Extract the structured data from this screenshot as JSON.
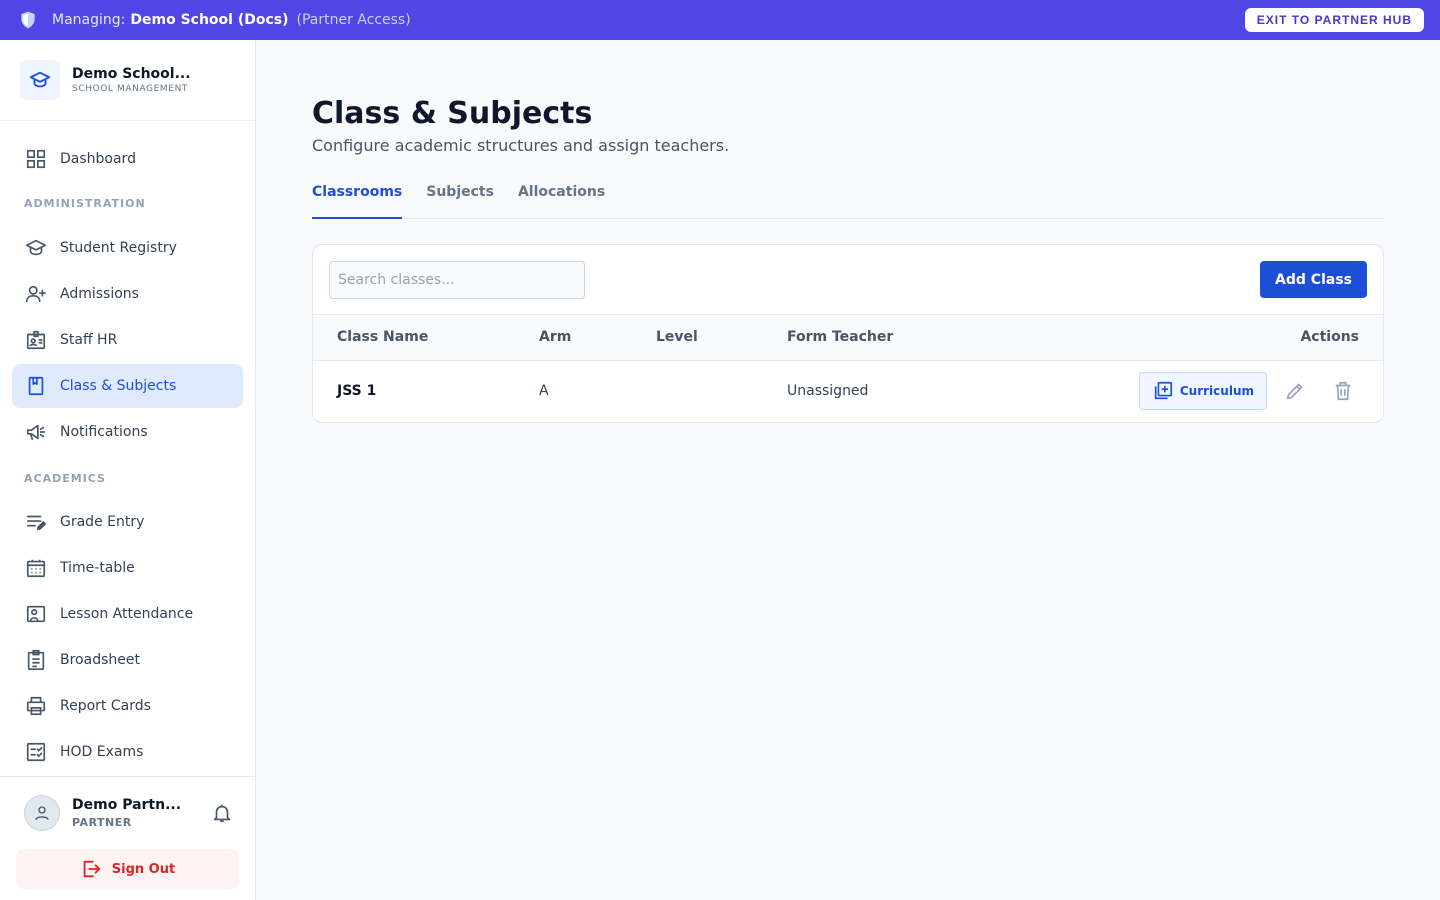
{
  "banner": {
    "managing_label": "Managing:",
    "school_name": "Demo School (Docs)",
    "access_note": "(Partner Access)",
    "exit_label": "EXIT TO PARTNER HUB",
    "icon": "shield-icon"
  },
  "brand": {
    "name": "Demo School...",
    "subtitle": "SCHOOL MANAGEMENT",
    "icon": "graduation-cap-icon"
  },
  "sidebar": {
    "dashboard": "Dashboard",
    "admin_section": "ADMINISTRATION",
    "admin_items": [
      {
        "label": "Student Registry",
        "icon": "graduation-cap-icon"
      },
      {
        "label": "Admissions",
        "icon": "user-plus-icon"
      },
      {
        "label": "Staff HR",
        "icon": "id-badge-icon"
      },
      {
        "label": "Class & Subjects",
        "icon": "book-icon",
        "active": true
      },
      {
        "label": "Notifications",
        "icon": "megaphone-icon"
      }
    ],
    "academics_section": "ACADEMICS",
    "academic_items": [
      {
        "label": "Grade Entry",
        "icon": "edit-list-icon"
      },
      {
        "label": "Time-table",
        "icon": "calendar-icon"
      },
      {
        "label": "Lesson Attendance",
        "icon": "present-icon"
      },
      {
        "label": "Broadsheet",
        "icon": "clipboard-icon"
      },
      {
        "label": "Report Cards",
        "icon": "printer-icon"
      },
      {
        "label": "HOD Exams",
        "icon": "checklist-icon"
      }
    ]
  },
  "user": {
    "name": "Demo Partn...",
    "role": "PARTNER",
    "sign_out": "Sign Out"
  },
  "page": {
    "title": "Class & Subjects",
    "subtitle": "Configure academic structures and assign teachers."
  },
  "tabs": [
    {
      "label": "Classrooms",
      "active": true
    },
    {
      "label": "Subjects"
    },
    {
      "label": "Allocations"
    }
  ],
  "toolbar": {
    "search_placeholder": "Search classes...",
    "add_label": "Add Class"
  },
  "table": {
    "headers": [
      "Class Name",
      "Arm",
      "Level",
      "Form Teacher",
      "Actions"
    ],
    "rows": [
      {
        "class_name": "JSS 1",
        "arm": "A",
        "level": "",
        "form_teacher": "Unassigned",
        "curriculum_label": "Curriculum"
      }
    ]
  },
  "colors": {
    "banner": "#4f46e5",
    "accent": "#1d4ed8",
    "danger": "#dc2626"
  }
}
